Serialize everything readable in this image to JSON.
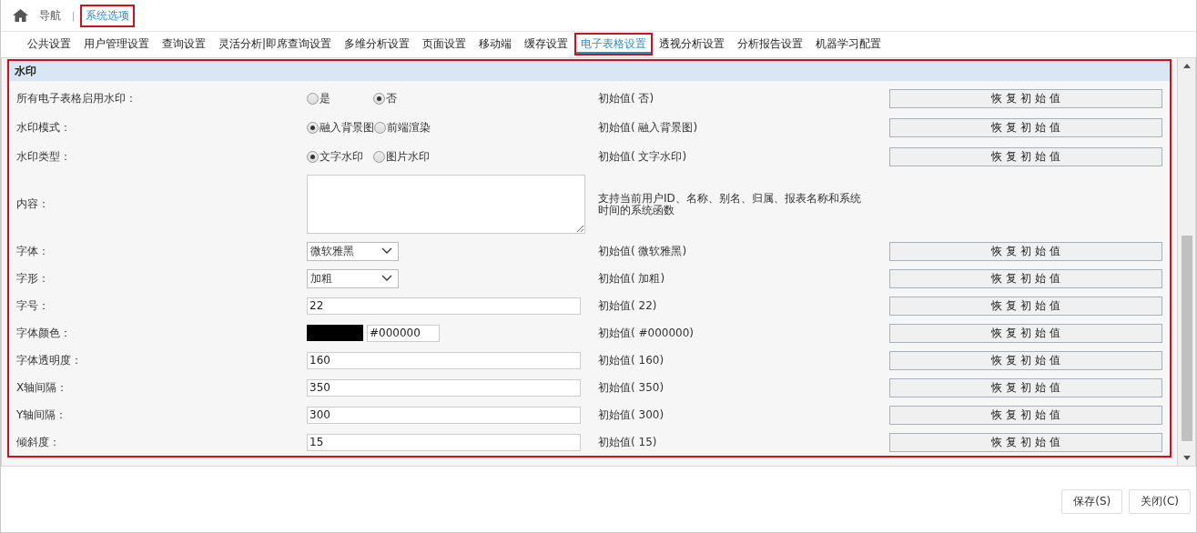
{
  "breadcrumb": {
    "items": [
      {
        "label": "导航",
        "selected": false,
        "highlighted": false
      },
      {
        "label": "系统选项",
        "selected": true,
        "highlighted": true
      }
    ],
    "separator": "|"
  },
  "tabs": [
    {
      "label": "公共设置",
      "selected": false,
      "highlighted": false
    },
    {
      "label": "用户管理设置",
      "selected": false,
      "highlighted": false
    },
    {
      "label": "查询设置",
      "selected": false,
      "highlighted": false
    },
    {
      "label": "灵活分析|即席查询设置",
      "selected": false,
      "highlighted": false
    },
    {
      "label": "多维分析设置",
      "selected": false,
      "highlighted": false
    },
    {
      "label": "页面设置",
      "selected": false,
      "highlighted": false
    },
    {
      "label": "移动端",
      "selected": false,
      "highlighted": false
    },
    {
      "label": "缓存设置",
      "selected": false,
      "highlighted": false
    },
    {
      "label": "电子表格设置",
      "selected": true,
      "highlighted": true
    },
    {
      "label": "透视分析设置",
      "selected": false,
      "highlighted": false
    },
    {
      "label": "分析报告设置",
      "selected": false,
      "highlighted": false
    },
    {
      "label": "机器学习配置",
      "selected": false,
      "highlighted": false
    }
  ],
  "section": {
    "title": "水印",
    "highlighted": true,
    "rows": [
      {
        "kind": "radio",
        "label": "所有电子表格启用水印：",
        "options": [
          {
            "label": "是",
            "selected": false
          },
          {
            "label": "否",
            "selected": true
          }
        ],
        "initial": "初始值( 否)",
        "restore": "恢 复 初 始 值"
      },
      {
        "kind": "radio",
        "label": "水印模式：",
        "options": [
          {
            "label": "融入背景图",
            "selected": true
          },
          {
            "label": "前端渲染",
            "selected": false
          }
        ],
        "initial": "初始值( 融入背景图)",
        "restore": "恢 复 初 始 值"
      },
      {
        "kind": "radio",
        "label": "水印类型：",
        "options": [
          {
            "label": "文字水印",
            "selected": true
          },
          {
            "label": "图片水印",
            "selected": false
          }
        ],
        "initial": "初始值( 文字水印)",
        "restore": "恢 复 初 始 值"
      },
      {
        "kind": "textarea",
        "label": "内容：",
        "note": "支持当前用户ID、名称、别名、归属、报表名称和系统时间的系统函数"
      },
      {
        "kind": "select",
        "label": "字体：",
        "value": "微软雅黑",
        "initial": "初始值( 微软雅黑)",
        "restore": "恢 复 初 始 值"
      },
      {
        "kind": "select",
        "label": "字形：",
        "value": "加粗",
        "initial": "初始值( 加粗)",
        "restore": "恢 复 初 始 值"
      },
      {
        "kind": "text",
        "label": "字号：",
        "value": "22",
        "initial": "初始值( 22)",
        "restore": "恢 复 初 始 值"
      },
      {
        "kind": "color",
        "label": "字体颜色：",
        "value": "#000000",
        "color": "#000000",
        "initial": "初始值( #000000)",
        "restore": "恢 复 初 始 值"
      },
      {
        "kind": "text",
        "label": "字体透明度：",
        "value": "160",
        "initial": "初始值( 160)",
        "restore": "恢 复 初 始 值"
      },
      {
        "kind": "text",
        "label": "X轴间隔：",
        "value": "350",
        "initial": "初始值( 350)",
        "restore": "恢 复 初 始 值"
      },
      {
        "kind": "text",
        "label": "Y轴间隔：",
        "value": "300",
        "initial": "初始值( 300)",
        "restore": "恢 复 初 始 值"
      },
      {
        "kind": "text",
        "label": "倾斜度：",
        "value": "15",
        "initial": "初始值( 15)",
        "restore": "恢 复 初 始 值"
      }
    ]
  },
  "buttons": [
    "保存(S)",
    "关闭(C)"
  ]
}
